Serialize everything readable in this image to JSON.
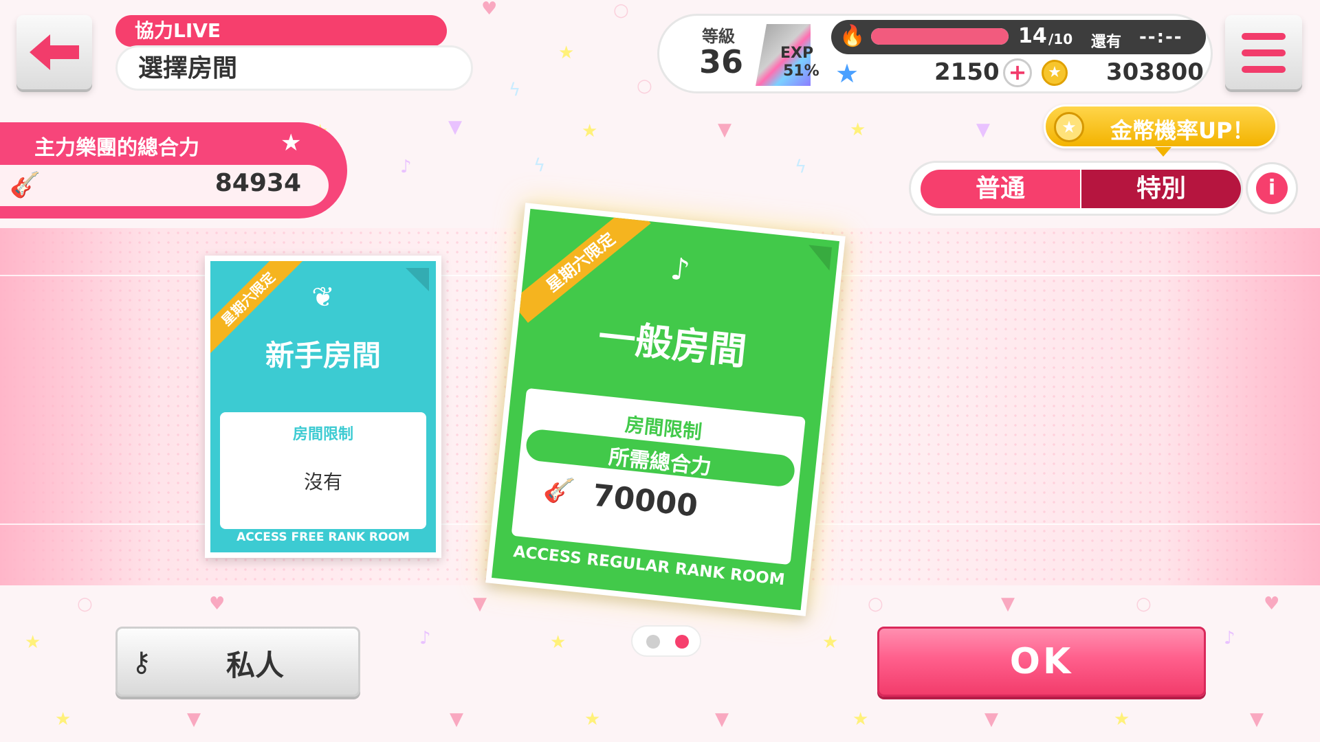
{
  "header": {
    "title": "協力LIVE",
    "subtitle": "選擇房間"
  },
  "status": {
    "level_label": "等級",
    "level_value": "36",
    "exp_label": "EXP",
    "exp_value": "51%",
    "stamina_count": "14",
    "stamina_max": "/10",
    "stamina_fill": 1.0,
    "remain_label": "還有",
    "remain_time": "--:--",
    "stars": "2150",
    "coins": "303800"
  },
  "band_power": {
    "label": "主力樂團的總合力",
    "value": "84934"
  },
  "coin_up": {
    "label": "金幣機率UP！"
  },
  "mode_toggle": {
    "normal": "普通",
    "special": "特別",
    "selected": "特別"
  },
  "rooms": [
    {
      "ribbon": "星期六限定",
      "title": "新手房間",
      "limit_label": "房間限制",
      "limit_value": "沒有",
      "footer": "ACCESS FREE RANK ROOM",
      "color": "#3ccbd2"
    },
    {
      "ribbon": "星期六限定",
      "title": "一般房間",
      "limit_label": "房間限制",
      "requirement_label": "所需總合力",
      "requirement_value": "70000",
      "footer": "ACCESS REGULAR RANK ROOM",
      "color": "#42c94a"
    }
  ],
  "pager": {
    "count": 2,
    "active": 2
  },
  "actions": {
    "private": "私人",
    "ok": "OK"
  },
  "colors": {
    "accent": "#f63f6d",
    "accent_dark": "#b6153f",
    "coin": "#f3b300"
  },
  "icons": {
    "back": "back-arrow-icon",
    "menu": "hamburger-icon",
    "flame": "flame-icon",
    "star": "star-icon",
    "coin": "coin-icon",
    "guitar": "guitar-icon",
    "key": "key-icon",
    "info": "info-icon"
  }
}
